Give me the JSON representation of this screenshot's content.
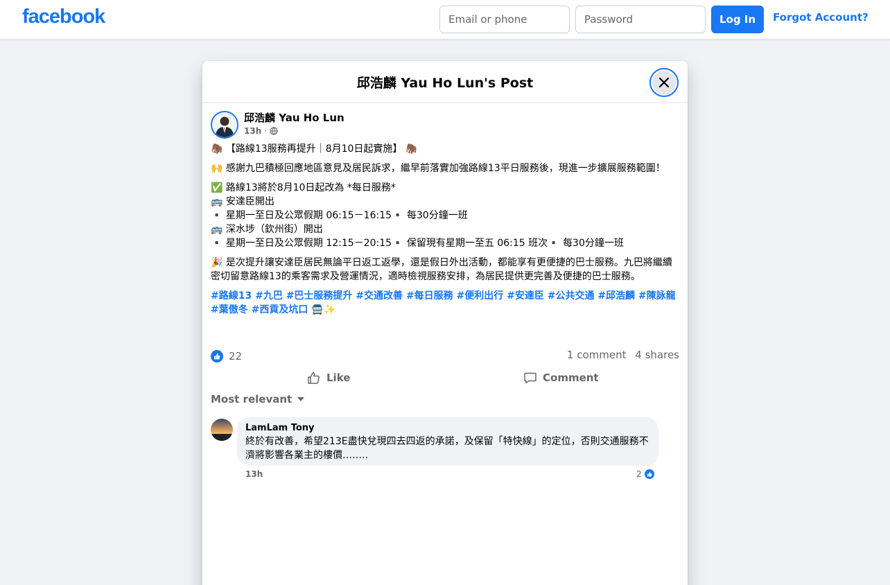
{
  "header": {
    "logo": "facebook",
    "email_placeholder": "Email or phone",
    "password_placeholder": "Password",
    "login_label": "Log In",
    "forgot_label": "Forgot Account?"
  },
  "dialog": {
    "title": "邱浩麟 Yau Ho Lun's Post",
    "close_icon": "close-icon"
  },
  "post": {
    "author": "邱浩麟 Yau Ho Lun",
    "time": "13h",
    "dot": "·",
    "privacy_icon": "globe-icon",
    "headline": "🦣 【路線13服務再提升｜8月10日起實施】 🦣",
    "intro": "🙌 感謝九巴積極回應地區意見及居民訴求，繼早前落實加強路線13平日服務後，現進一步擴展服務範圍！",
    "schedule": [
      "✅ 路線13將於8月10日起改為 *每日服務*",
      "🚌 安達臣開出",
      "▪️ 星期一至日及公眾假期 06:15－16:15▪️ 每30分鐘一班",
      "🚌 深水埗（欽州街）開出",
      "▪️ 星期一至日及公眾假期 12:15－20:15▪️ 保留現有星期一至五 06:15 班次▪️ 每30分鐘一班"
    ],
    "closing": "🎉 是次提升讓安達臣居民無論平日返工返學，還是假日外出活動，都能享有更便捷的巴士服務。九巴將繼續密切留意路線13的乘客需求及營運情況，適時檢視服務安排，為居民提供更完善及便捷的巴士服務。",
    "hashtags": "#路線13 #九巴 #巴士服務提升 #交通改善 #每日服務 #便利出行 #安達臣 #公共交通 #邱浩麟 #陳詠龍 #葉傲冬 #西貢及坑口 🚍✨",
    "reactions": "22",
    "comments_count": "1 comment",
    "shares_count": "4 shares",
    "like_label": "Like",
    "comment_label": "Comment"
  },
  "comments": {
    "sort_label": "Most relevant",
    "items": [
      {
        "name": "LamLam Tony",
        "text": "終於有改善，希望213E盡快兌現四去四返的承諾，及保留「特快線」的定位，否則交通服務不濟將影響各業主的樓價……..",
        "time": "13h",
        "likes": "2"
      }
    ]
  },
  "colors": {
    "brand": "#1877f2",
    "background": "#f0f2f5",
    "muted_text": "#65676b"
  }
}
